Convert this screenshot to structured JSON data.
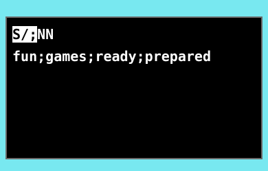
{
  "colors": {
    "frame_background": "#78e8f0",
    "terminal_background": "#000000",
    "terminal_text": "#ffffff",
    "selection_background": "#ffffff",
    "selection_text": "#000000"
  },
  "terminal": {
    "command_line": {
      "selected_text": "S/;",
      "rest_text": "NN"
    },
    "output_line": "fun;games;ready;prepared"
  }
}
